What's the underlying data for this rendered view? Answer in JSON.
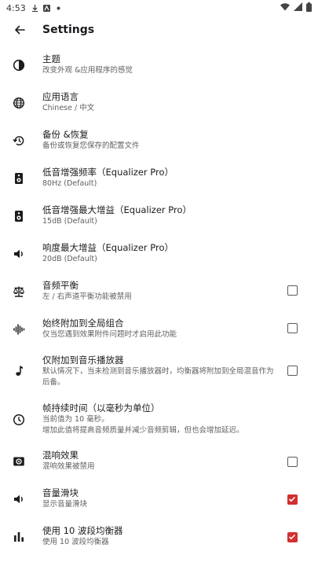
{
  "status": {
    "time": "4:53"
  },
  "header": {
    "title": "Settings"
  },
  "items": [
    {
      "title": "主题",
      "subtitle": "改变外观 &应用程序的感觉",
      "icon": "contrast-icon"
    },
    {
      "title": "应用语言",
      "subtitle": "Chinese / 中文",
      "icon": "globe-icon"
    },
    {
      "title": "备份 &恢复",
      "subtitle": "备份或恢复您保存的配置文件",
      "icon": "restore-icon"
    },
    {
      "title": "低音增强频率（Equalizer Pro）",
      "subtitle": "80Hz (Default)",
      "icon": "speaker-icon"
    },
    {
      "title": "低音增强最大增益（Equalizer Pro）",
      "subtitle": "15dB (Default)",
      "icon": "speaker-icon"
    },
    {
      "title": "响度最大增益（Equalizer Pro）",
      "subtitle": "20dB (Default)",
      "icon": "volume-icon"
    },
    {
      "title": "音频平衡",
      "subtitle": "左 / 右声道平衡功能被禁用",
      "icon": "balance-icon",
      "checked": false
    },
    {
      "title": "始终附加到全局组合",
      "subtitle": "仅当您遇到效果附件问题时才启用此功能",
      "icon": "waveform-icon",
      "checked": false
    },
    {
      "title": "仅附加到音乐播放器",
      "subtitle": "默认情况下，当未检测到音乐播放器时，均衡器将附加到全局混音作为后备。",
      "icon": "music-note-icon",
      "checked": false
    },
    {
      "title": "帧持续时间（以毫秒为单位）",
      "subtitle": "当前值为 10 毫秒。\n增加此值将提高音频质量并减少音频剪辑，但也会增加延迟。",
      "icon": "clock-icon"
    },
    {
      "title": "混响效果",
      "subtitle": "混响效果被禁用",
      "icon": "surround-sound-icon",
      "checked": false
    },
    {
      "title": "音量滑块",
      "subtitle": "显示音量滑块",
      "icon": "volume-icon",
      "checked": true
    },
    {
      "title": "使用 10 波段均衡器",
      "subtitle": "使用 10 波段均衡器",
      "icon": "equalizer-bars-icon",
      "checked": true
    }
  ],
  "colors": {
    "accent": "#d32f2f",
    "text": "#1c1b1f",
    "secondary": "#5f5f63"
  }
}
